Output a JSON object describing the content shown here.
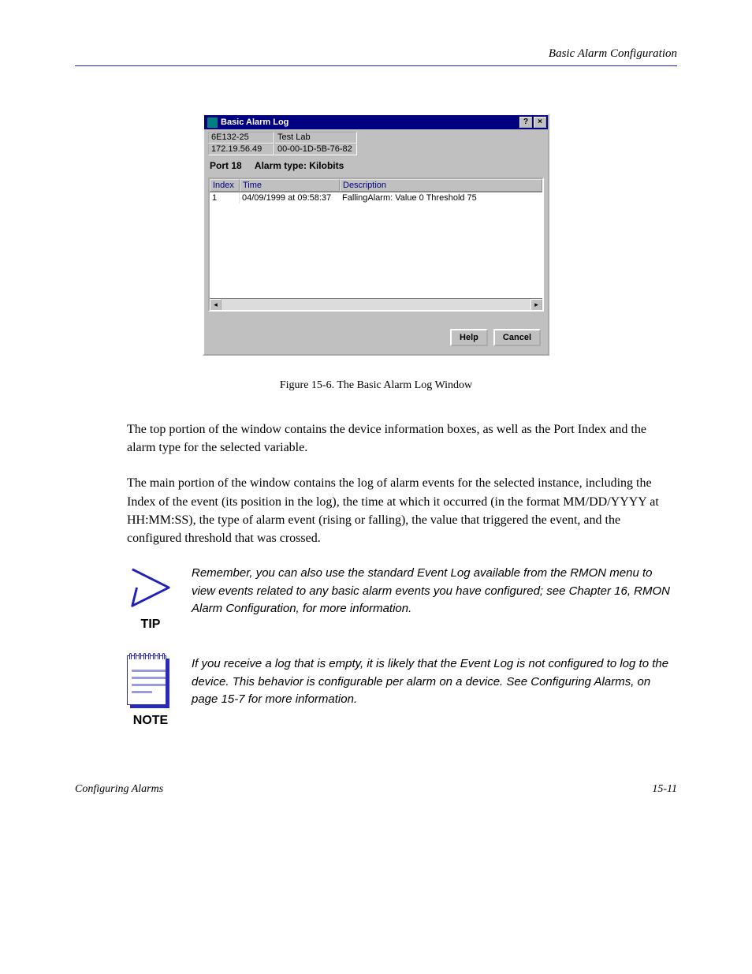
{
  "running_header": "Basic Alarm Configuration",
  "dialog": {
    "title": "Basic Alarm Log",
    "help_btn": "?",
    "close_btn": "×",
    "info_device_model": "6E132-25",
    "info_device_loc": "Test Lab",
    "info_device_ip": "172.19.56.49",
    "info_device_mac": "00-00-1D-5B-76-82",
    "port_label": "Port 18",
    "alarm_type_prefix": "Alarm type:",
    "alarm_type_value": "Kilobits",
    "cols": {
      "index": "Index",
      "time": "Time",
      "desc": "Description"
    },
    "rows": [
      {
        "index": "1",
        "time": "04/09/1999 at 09:58:37",
        "desc": "FallingAlarm: Value 0  Threshold 75"
      }
    ],
    "buttons": {
      "help": "Help",
      "cancel": "Cancel"
    }
  },
  "figure_caption": "Figure 15-6. The Basic Alarm Log Window",
  "para1": "The top portion of the window contains the device information boxes, as well as the Port Index and the alarm type for the selected variable.",
  "para2": "The main portion of the window contains the log of alarm events for the selected instance, including the Index of the event (its position in the log), the time at which it occurred (in the format MM/DD/YYYY at HH:MM:SS), the type of alarm event (rising or falling), the value that triggered the event, and the configured threshold that was crossed.",
  "tip_label": "TIP",
  "tip_text": "Remember, you can also use the standard Event Log available from the RMON menu to view events related to any basic alarm events you have configured; see Chapter 16, RMON Alarm Configuration, for more information.",
  "note_label": "NOTE",
  "note_text": "If you receive a log that is empty, it is likely that the Event Log is not configured to log to the device. This behavior is configurable per alarm on a device. See Configuring Alarms, on page 15-7 for more information.",
  "footer_left": "Configuring Alarms",
  "footer_right": "15-11"
}
